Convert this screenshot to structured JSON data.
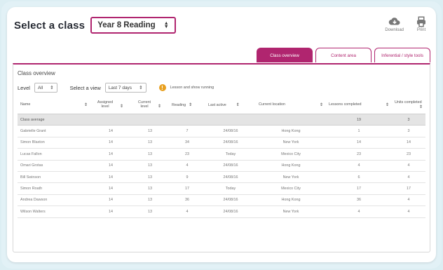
{
  "header": {
    "title": "Select a class",
    "class_select": "Year 8 Reading"
  },
  "tools": [
    {
      "label": "Download",
      "icon": "download-cloud-icon"
    },
    {
      "label": "Print",
      "icon": "printer-icon"
    }
  ],
  "tabs": [
    {
      "label": "Class overview",
      "active": true
    },
    {
      "label": "Content area",
      "active": false
    },
    {
      "label": "Inferential / style tools",
      "active": false
    }
  ],
  "panel": {
    "title": "Class overview",
    "level_label": "Level",
    "level_value": "All",
    "view_label": "Select a view",
    "view_value": "Last 7 days",
    "warning": "Lesson and show running"
  },
  "table": {
    "columns": [
      "Name",
      "Assigned level",
      "Current level",
      "Reading",
      "Last active",
      "Current location",
      "Lessons completed",
      "Units completed"
    ],
    "average_row": [
      "Class average",
      "",
      "",
      "",
      "",
      "",
      "19",
      "3"
    ],
    "rows": [
      [
        "Gabrielle Grant",
        "14",
        "13",
        "7",
        "24/08/16",
        "Hong Kong",
        "1",
        "3"
      ],
      [
        "Simon Blaxton",
        "14",
        "13",
        "34",
        "24/08/16",
        "New York",
        "14",
        "14"
      ],
      [
        "Lucas Fallon",
        "14",
        "13",
        "23",
        "Today",
        "Mexico City",
        "23",
        "23"
      ],
      [
        "Omari Grotas",
        "14",
        "13",
        "4",
        "24/08/16",
        "Hong Kong",
        "4",
        "4"
      ],
      [
        "Bill Swinson",
        "14",
        "13",
        "9",
        "24/08/16",
        "New York",
        "6",
        "4"
      ],
      [
        "Simon Roath",
        "14",
        "13",
        "17",
        "Today",
        "Mexico City",
        "17",
        "17"
      ],
      [
        "Andrea Dawson",
        "14",
        "13",
        "36",
        "24/08/16",
        "Hong Kong",
        "36",
        "4"
      ],
      [
        "Wilson Walters",
        "14",
        "13",
        "4",
        "24/08/16",
        "New York",
        "4",
        "4"
      ]
    ]
  },
  "colors": {
    "accent": "#b0256f",
    "warning": "#e8a020",
    "background": "#e2f1f6"
  }
}
